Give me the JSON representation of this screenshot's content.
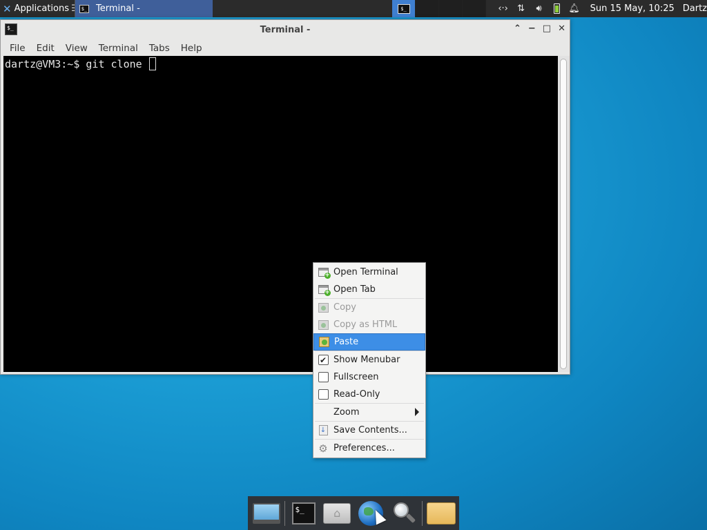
{
  "top_panel": {
    "applications_label": "Applications",
    "task_title": "Terminal -",
    "tray_icons": [
      "network-arrows-icon",
      "transfer-arrows-icon",
      "volume-icon",
      "battery-icon",
      "notification-bell-icon"
    ],
    "clock": "Sun 15 May, 10:25",
    "user": "Dartz"
  },
  "window": {
    "title": "Terminal -",
    "menu": [
      "File",
      "Edit",
      "View",
      "Terminal",
      "Tabs",
      "Help"
    ],
    "prompt": "dartz@VM3:~$ git clone "
  },
  "context_menu": {
    "items": [
      {
        "label": "Open Terminal",
        "icon": "open-terminal-icon",
        "enabled": true
      },
      {
        "label": "Open Tab",
        "icon": "open-tab-icon",
        "enabled": true
      },
      {
        "label": "Copy",
        "icon": "copy-icon",
        "enabled": false
      },
      {
        "label": "Copy as HTML",
        "icon": "copy-html-icon",
        "enabled": false
      },
      {
        "label": "Paste",
        "icon": "paste-icon",
        "enabled": true,
        "highlighted": true
      },
      {
        "label": "Show Menubar",
        "checked": true
      },
      {
        "label": "Fullscreen",
        "checked": false
      },
      {
        "label": "Read-Only",
        "checked": false
      },
      {
        "label": "Zoom",
        "submenu": true
      },
      {
        "label": "Save Contents...",
        "icon": "save-icon"
      },
      {
        "label": "Preferences...",
        "icon": "gear-icon"
      }
    ]
  },
  "dock": {
    "items": [
      "show-desktop-icon",
      "terminal-icon",
      "home-folder-icon",
      "web-browser-icon",
      "search-icon",
      "folder-icon"
    ]
  },
  "colors": {
    "panel_bg": "#2b2b2b",
    "highlight": "#3d8ee6",
    "terminal_bg": "#000000",
    "desktop": "#1c9fd6"
  }
}
